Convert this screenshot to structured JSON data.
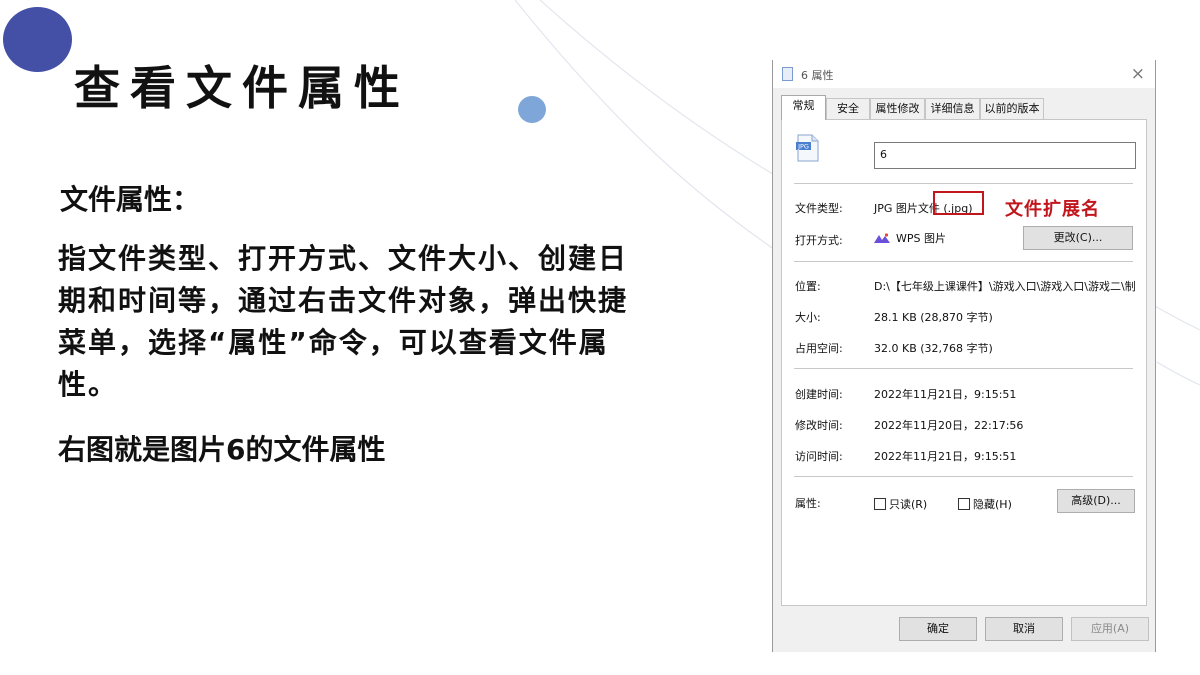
{
  "slide": {
    "title": "查看文件属性",
    "subheading": "文件属性：",
    "body": "指文件类型、打开方式、文件大小、创建日期和时间等，通过右击文件对象，弹出快捷菜单，选择“属性”命令，可以查看文件属性。",
    "note": "右图就是图片6的文件属性"
  },
  "dialog": {
    "title": "6 属性",
    "close_glyph": "×",
    "tabs": [
      {
        "label": "常规",
        "active": true
      },
      {
        "label": "安全",
        "active": false
      },
      {
        "label": "属性修改",
        "active": false
      },
      {
        "label": "详细信息",
        "active": false
      },
      {
        "label": "以前的版本",
        "active": false
      }
    ],
    "file_icon_text": "JPG",
    "file_name": "6",
    "rows": {
      "type_label": "文件类型:",
      "type_value": "JPG 图片文件 (.jpg)",
      "open_label": "打开方式:",
      "open_value": "WPS 图片",
      "change_button": "更改(C)...",
      "location_label": "位置:",
      "location_value": "D:\\【七年级上课课件】\\游戏入口\\游戏入口\\游戏二\\制",
      "size_label": "大小:",
      "size_value": "28.1 KB (28,870 字节)",
      "disk_label": "占用空间:",
      "disk_value": "32.0 KB (32,768 字节)",
      "created_label": "创建时间:",
      "created_value": "2022年11月21日，9:15:51",
      "modified_label": "修改时间:",
      "modified_value": "2022年11月20日，22:17:56",
      "accessed_label": "访问时间:",
      "accessed_value": "2022年11月21日，9:15:51",
      "attr_label": "属性:",
      "readonly_label": "只读(R)",
      "hidden_label": "隐藏(H)",
      "advanced_button": "高级(D)..."
    },
    "footer": {
      "ok": "确定",
      "cancel": "取消",
      "apply": "应用(A)"
    }
  },
  "annotation": {
    "label": "文件扩展名",
    "color": "#c0161c"
  },
  "colors": {
    "accent_dark": "#4450a6",
    "accent_light": "#7fa6d8"
  }
}
